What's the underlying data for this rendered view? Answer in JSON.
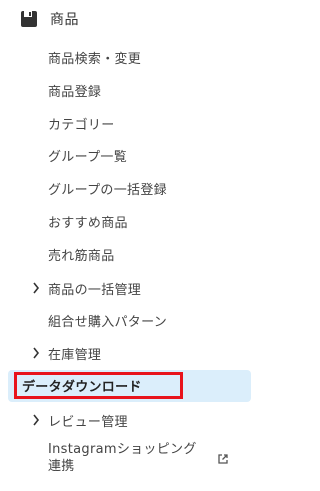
{
  "section": {
    "title": "商品",
    "icon": "save-icon"
  },
  "menu": {
    "item_search": "商品検索・変更",
    "item_register": "商品登録",
    "item_category": "カテゴリー",
    "item_group_list": "グループ一覧",
    "item_group_bulk": "グループの一括登録",
    "item_recommend": "おすすめ商品",
    "item_bestseller": "売れ筋商品",
    "item_bulk_manage": "商品の一括管理",
    "item_combo": "組合せ購入パターン",
    "item_stock": "在庫管理",
    "item_download": "データダウンロード",
    "item_review": "レビュー管理",
    "item_instagram_line1": "Instagramショッピング",
    "item_instagram_line2": "連携"
  },
  "colors": {
    "active_bg": "#dbeefb",
    "highlight_border": "#e8131b"
  }
}
